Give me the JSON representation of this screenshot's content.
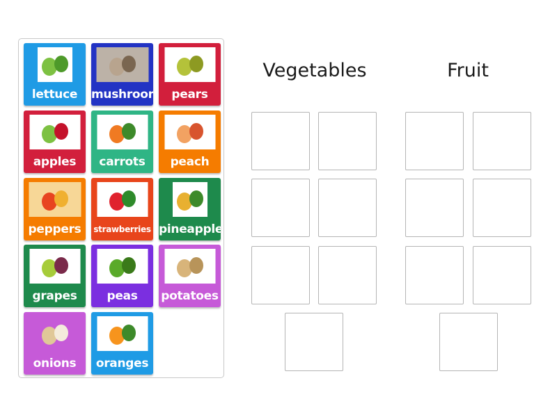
{
  "tray": {
    "tiles": [
      {
        "label": "lettuce",
        "color": "#1f9be5",
        "icon": "lettuce-icon",
        "pic_colors": [
          "#7dc142",
          "#4e9a2a"
        ]
      },
      {
        "label": "mushrooms",
        "color": "#2233c4",
        "icon": "mushrooms-icon",
        "pic_colors": [
          "#b8a48e",
          "#7a6650"
        ]
      },
      {
        "label": "pears",
        "color": "#d21f3c",
        "icon": "pears-icon",
        "pic_colors": [
          "#b4c23a",
          "#8d9a22"
        ]
      },
      {
        "label": "apples",
        "color": "#d21f3c",
        "icon": "apples-icon",
        "pic_colors": [
          "#7dc142",
          "#c4122a"
        ]
      },
      {
        "label": "carrots",
        "color": "#2fb585",
        "icon": "carrots-icon",
        "pic_colors": [
          "#f07a22",
          "#3d8a2a"
        ]
      },
      {
        "label": "peach",
        "color": "#f57c00",
        "icon": "peach-icon",
        "pic_colors": [
          "#f2a262",
          "#d8542e"
        ]
      },
      {
        "label": "peppers",
        "color": "#f57c00",
        "icon": "peppers-icon",
        "pic_colors": [
          "#e84420",
          "#f0b030"
        ]
      },
      {
        "label": "strawberries",
        "color": "#e8451b",
        "icon": "strawberries-icon",
        "pic_colors": [
          "#e0222e",
          "#2e8a2a"
        ]
      },
      {
        "label": "pineapple",
        "color": "#1e8a4c",
        "icon": "pineapple-icon",
        "pic_colors": [
          "#e8b030",
          "#3d8a2a"
        ]
      },
      {
        "label": "grapes",
        "color": "#1e8a4c",
        "icon": "grapes-icon",
        "pic_colors": [
          "#a6cc3a",
          "#7a2a4a"
        ]
      },
      {
        "label": "peas",
        "color": "#7b2fe0",
        "icon": "peas-icon",
        "pic_colors": [
          "#5aaa2a",
          "#3a7a1a"
        ]
      },
      {
        "label": "potatoes",
        "color": "#c65ad8",
        "icon": "potatoes-icon",
        "pic_colors": [
          "#d8b47a",
          "#b8945a"
        ]
      },
      {
        "label": "onions",
        "color": "#c65ad8",
        "icon": "onions-icon",
        "pic_colors": [
          "#e0c898",
          "#f4ecdc"
        ]
      },
      {
        "label": "oranges",
        "color": "#1f9be5",
        "icon": "oranges-icon",
        "pic_colors": [
          "#f7941d",
          "#3d8a2a"
        ]
      }
    ]
  },
  "groups": [
    {
      "title": "Vegetables",
      "slots": 7
    },
    {
      "title": "Fruit",
      "slots": 7
    }
  ]
}
